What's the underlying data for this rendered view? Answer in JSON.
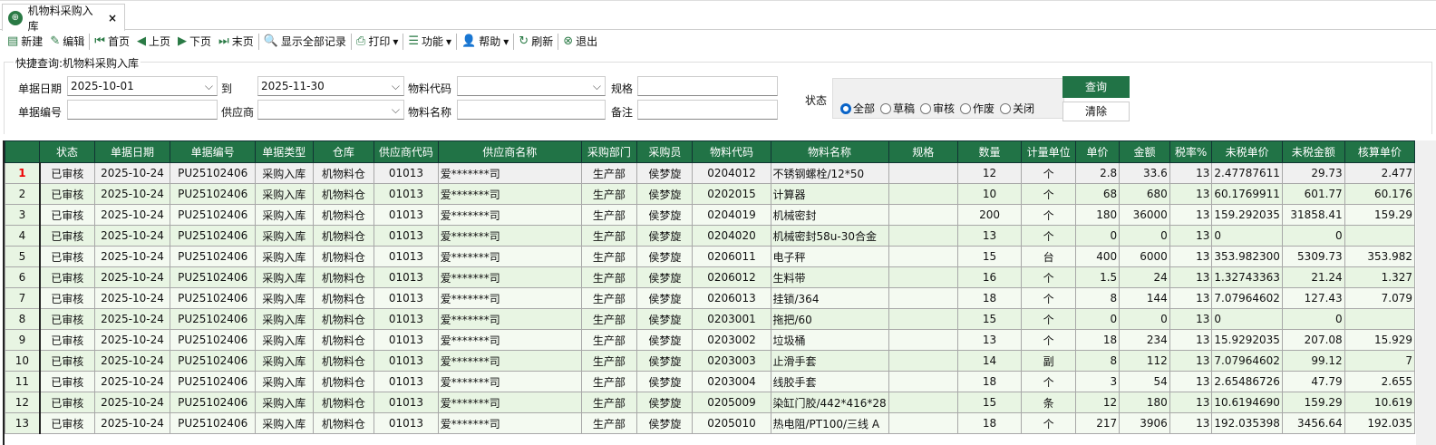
{
  "tab": {
    "title": "机物料采购入库",
    "close": "×"
  },
  "toolbar": [
    {
      "icon": "new-doc-icon",
      "glyph": "▤",
      "label": "新建"
    },
    {
      "icon": "edit-icon",
      "glyph": "✎",
      "label": "编辑"
    },
    {
      "icon": "first-page-icon",
      "glyph": "⏮",
      "label": "首页"
    },
    {
      "icon": "prev-page-icon",
      "glyph": "◀",
      "label": "上页"
    },
    {
      "icon": "next-page-icon",
      "glyph": "▶",
      "label": "下页"
    },
    {
      "icon": "last-page-icon",
      "glyph": "⏭",
      "label": "末页"
    },
    {
      "icon": "search-all-icon",
      "glyph": "🔍",
      "label": "显示全部记录"
    },
    {
      "icon": "print-icon",
      "glyph": "⎙",
      "label": "打印",
      "dropdown": "▾"
    },
    {
      "icon": "list-icon",
      "glyph": "☰",
      "label": "功能",
      "dropdown": "▾"
    },
    {
      "icon": "help-icon",
      "glyph": "👤",
      "label": "帮助",
      "dropdown": "▾"
    },
    {
      "icon": "refresh-icon",
      "glyph": "↻",
      "label": "刷新"
    },
    {
      "icon": "exit-icon",
      "glyph": "⊗",
      "label": "退出"
    }
  ],
  "query": {
    "title": "快捷查询:机物料采购入库",
    "date_label": "单据日期",
    "date_from": "2025-10-01",
    "to_label": "到",
    "date_to": "2025-11-30",
    "material_code_label": "物料代码",
    "material_code": "",
    "spec_label": "规格",
    "spec": "",
    "doc_no_label": "单据编号",
    "doc_no": "",
    "supplier_label": "供应商",
    "supplier": "",
    "material_name_label": "物料名称",
    "material_name": "",
    "remark_label": "备注",
    "remark": "",
    "status_label": "状态",
    "status_options": [
      "全部",
      "草稿",
      "审核",
      "作废",
      "关闭"
    ],
    "status_selected": 0,
    "query_button": "查询",
    "clear_button": "清除"
  },
  "grid": {
    "columns": [
      "状态",
      "单据日期",
      "单据编号",
      "单据类型",
      "仓库",
      "供应商代码",
      "供应商名称",
      "采购部门",
      "采购员",
      "物料代码",
      "物料名称",
      "规格",
      "数量",
      "计量单位",
      "单价",
      "金额",
      "税率%",
      "未税单价",
      "未税金额",
      "核算单价"
    ],
    "rows": [
      [
        "1",
        "已审核",
        "2025-10-24",
        "PU25102406",
        "采购入库",
        "机物料仓",
        "01013",
        "爱*******司",
        "生产部",
        "侯梦旋",
        "0204012",
        "不锈钢螺栓/12*50",
        "",
        "12",
        "个",
        "2.8",
        "33.6",
        "13",
        "2.47787611",
        "29.73",
        "2.477"
      ],
      [
        "2",
        "已审核",
        "2025-10-24",
        "PU25102406",
        "采购入库",
        "机物料仓",
        "01013",
        "爱*******司",
        "生产部",
        "侯梦旋",
        "0202015",
        "计算器",
        "",
        "10",
        "个",
        "68",
        "680",
        "13",
        "60.1769911",
        "601.77",
        "60.176"
      ],
      [
        "3",
        "已审核",
        "2025-10-24",
        "PU25102406",
        "采购入库",
        "机物料仓",
        "01013",
        "爱*******司",
        "生产部",
        "侯梦旋",
        "0204019",
        "机械密封",
        "",
        "200",
        "个",
        "180",
        "36000",
        "13",
        "159.292035",
        "31858.41",
        "159.29"
      ],
      [
        "4",
        "已审核",
        "2025-10-24",
        "PU25102406",
        "采购入库",
        "机物料仓",
        "01013",
        "爱*******司",
        "生产部",
        "侯梦旋",
        "0204020",
        "机械密封58u-30合金",
        "",
        "13",
        "个",
        "0",
        "0",
        "13",
        "0",
        "0",
        ""
      ],
      [
        "5",
        "已审核",
        "2025-10-24",
        "PU25102406",
        "采购入库",
        "机物料仓",
        "01013",
        "爱*******司",
        "生产部",
        "侯梦旋",
        "0206011",
        "电子秤",
        "",
        "15",
        "台",
        "400",
        "6000",
        "13",
        "353.982300",
        "5309.73",
        "353.982"
      ],
      [
        "6",
        "已审核",
        "2025-10-24",
        "PU25102406",
        "采购入库",
        "机物料仓",
        "01013",
        "爱*******司",
        "生产部",
        "侯梦旋",
        "0206012",
        "生料带",
        "",
        "16",
        "个",
        "1.5",
        "24",
        "13",
        "1.32743363",
        "21.24",
        "1.327"
      ],
      [
        "7",
        "已审核",
        "2025-10-24",
        "PU25102406",
        "采购入库",
        "机物料仓",
        "01013",
        "爱*******司",
        "生产部",
        "侯梦旋",
        "0206013",
        "挂锁/364",
        "",
        "18",
        "个",
        "8",
        "144",
        "13",
        "7.07964602",
        "127.43",
        "7.079"
      ],
      [
        "8",
        "已审核",
        "2025-10-24",
        "PU25102406",
        "采购入库",
        "机物料仓",
        "01013",
        "爱*******司",
        "生产部",
        "侯梦旋",
        "0203001",
        "拖把/60",
        "",
        "15",
        "个",
        "0",
        "0",
        "13",
        "0",
        "0",
        ""
      ],
      [
        "9",
        "已审核",
        "2025-10-24",
        "PU25102406",
        "采购入库",
        "机物料仓",
        "01013",
        "爱*******司",
        "生产部",
        "侯梦旋",
        "0203002",
        "垃圾桶",
        "",
        "13",
        "个",
        "18",
        "234",
        "13",
        "15.9292035",
        "207.08",
        "15.929"
      ],
      [
        "10",
        "已审核",
        "2025-10-24",
        "PU25102406",
        "采购入库",
        "机物料仓",
        "01013",
        "爱*******司",
        "生产部",
        "侯梦旋",
        "0203003",
        "止滑手套",
        "",
        "14",
        "副",
        "8",
        "112",
        "13",
        "7.07964602",
        "99.12",
        "7"
      ],
      [
        "11",
        "已审核",
        "2025-10-24",
        "PU25102406",
        "采购入库",
        "机物料仓",
        "01013",
        "爱*******司",
        "生产部",
        "侯梦旋",
        "0203004",
        "线胶手套",
        "",
        "18",
        "个",
        "3",
        "54",
        "13",
        "2.65486726",
        "47.79",
        "2.655"
      ],
      [
        "12",
        "已审核",
        "2025-10-24",
        "PU25102406",
        "采购入库",
        "机物料仓",
        "01013",
        "爱*******司",
        "生产部",
        "侯梦旋",
        "0205009",
        "染缸门胶/442*416*28",
        "",
        "15",
        "条",
        "12",
        "180",
        "13",
        "10.6194690",
        "159.29",
        "10.619"
      ],
      [
        "13",
        "已审核",
        "2025-10-24",
        "PU25102406",
        "采购入库",
        "机物料仓",
        "01013",
        "爱*******司",
        "生产部",
        "侯梦旋",
        "0205010",
        "热电阻/PT100/三线 A",
        "",
        "18",
        "个",
        "217",
        "3906",
        "13",
        "192.035398",
        "3456.64",
        "192.035"
      ]
    ]
  }
}
